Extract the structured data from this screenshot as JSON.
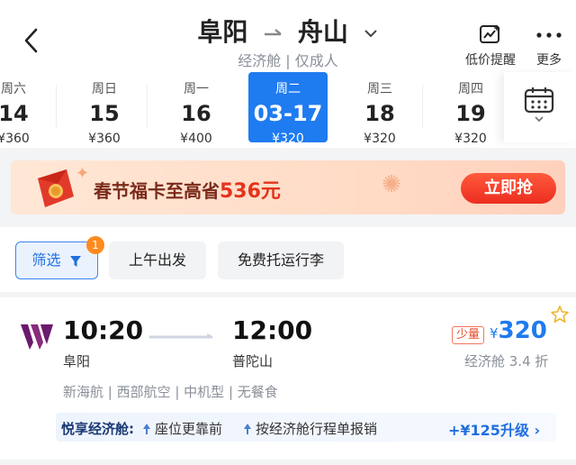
{
  "header": {
    "origin": "阜阳",
    "destination": "舟山",
    "subtitle": "经济舱 | 仅成人",
    "price_alert_label": "低价提醒",
    "more_label": "更多"
  },
  "dates": [
    {
      "weekday": "周六",
      "day": "14",
      "price": "¥360"
    },
    {
      "weekday": "周日",
      "day": "15",
      "price": "¥360"
    },
    {
      "weekday": "周一",
      "day": "16",
      "price": "¥400"
    },
    {
      "weekday": "周二",
      "day": "03-17",
      "price": "¥320",
      "selected": true
    },
    {
      "weekday": "周三",
      "day": "18",
      "price": "¥320"
    },
    {
      "weekday": "周四",
      "day": "19",
      "price": "¥320"
    }
  ],
  "banner": {
    "text_prefix": "春节福卡至高省",
    "amount": "536元",
    "cta": "立即抢"
  },
  "filters": {
    "filter_label": "筛选",
    "filter_count": "1",
    "chips": [
      "上午出发",
      "免费托运行李"
    ]
  },
  "flight": {
    "dep_time": "10:20",
    "arr_time": "12:00",
    "dep_airport": "阜阳",
    "arr_airport": "普陀山",
    "info": "新海航 | 西部航空 | 中机型 | 无餐食",
    "low_stock": "少量",
    "currency": "¥",
    "price": "320",
    "cabin_discount": "经济舱 3.4 折",
    "perks_title": "悦享经济舱:",
    "perk_1": "座位更靠前",
    "perk_2": "按经济舱行程单报销",
    "upgrade": "+¥125升级 ›"
  },
  "colors": {
    "accent": "#1f7bf0",
    "cta_red": "#ec2d20",
    "badge_orange": "#ff8a1d",
    "airline_logo": "#6b1a6e"
  },
  "icons": [
    "back-arrow-icon",
    "route-arrow-icon",
    "chevron-down-icon",
    "price-alert-icon",
    "more-dots-icon",
    "calendar-icon",
    "red-envelope-icon",
    "filter-funnel-icon",
    "airline-logo-icon",
    "star-icon",
    "perk-arrow-icon"
  ]
}
